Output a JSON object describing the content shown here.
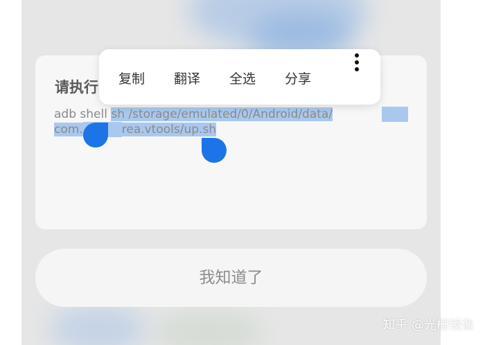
{
  "dialog": {
    "title": "请执行",
    "command": {
      "unselected_prefix": "adb shell ",
      "selected_line1": "sh /storage/emulated/0/Android/data/",
      "selected_line2_start": "com.",
      "selected_line2_end": "rea.vtools/up.sh"
    },
    "confirm_label": "我知道了"
  },
  "context_menu": {
    "items": [
      "复制",
      "翻译",
      "全选",
      "分享"
    ],
    "more_icon": "more-vertical-icon"
  },
  "watermark": "知乎 @光栅镜像",
  "colors": {
    "selection": "#aac8ee",
    "handle": "#1d74e6"
  }
}
